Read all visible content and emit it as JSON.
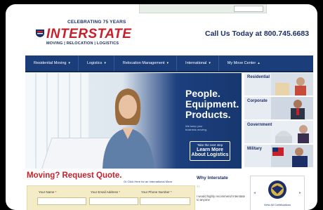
{
  "header": {
    "tagline": "CELEBRATING 75 YEARS",
    "brand": "INTERSTATE",
    "brand_sub": "MOVING | RELOCATION | LOGISTICS",
    "call": "Call Us Today at 800.745.6683"
  },
  "nav": [
    {
      "label": "Residential Moving",
      "arrow": "▾"
    },
    {
      "label": "Logistics",
      "arrow": "▾"
    },
    {
      "label": "Relocation Management",
      "arrow": "▾"
    },
    {
      "label": "International",
      "arrow": "▾"
    },
    {
      "label": "My Move Center",
      "arrow": "▴"
    }
  ],
  "hero": {
    "heading_line1": "People.",
    "heading_line2": "Equipment.",
    "heading_line3": "Products.",
    "small_line1": "We keep your",
    "small_line2": "business moving.",
    "cta_small": "Take the next step",
    "cta_line1": "Learn More",
    "cta_line2": "About Logistics"
  },
  "tiles": [
    "Residential",
    "Corporate",
    "Government",
    "Military"
  ],
  "quote": {
    "title": "Moving? Request Quote.",
    "intl_link": "Or Click Here for an International Move",
    "fields": [
      {
        "label": "Your Name",
        "req": "*"
      },
      {
        "label": "Your Email Address",
        "req": "*"
      },
      {
        "label": "Your Phone Number",
        "req": "*"
      }
    ]
  },
  "why": {
    "title": "Why Interstate",
    "quote_mark": "“",
    "text": "I would highly recommend Interstate to anyone"
  },
  "badge": {
    "caption": "View All Certifications",
    "prev": "◂",
    "next": "▸"
  },
  "colors": {
    "brand_red": "#c8202a",
    "brand_navy": "#1b2e66",
    "nav_blue": "#1b3d7a",
    "form_bg": "#f4ecc6"
  }
}
